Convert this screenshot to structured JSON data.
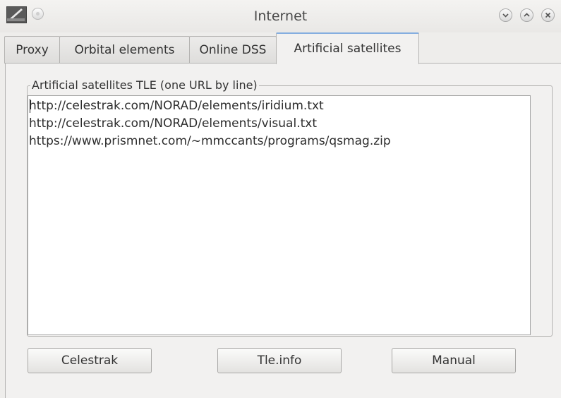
{
  "window": {
    "title": "Internet",
    "controls": [
      "minimize",
      "maximize",
      "close"
    ]
  },
  "tabs": [
    {
      "label": "Proxy",
      "active": false
    },
    {
      "label": "Orbital elements",
      "active": false
    },
    {
      "label": "Online DSS",
      "active": false
    },
    {
      "label": "Artificial satellites",
      "active": true
    }
  ],
  "satellites": {
    "group_label": "Artificial satellites TLE (one URL by line)",
    "urls": [
      "http://celestrak.com/NORAD/elements/iridium.txt",
      "http://celestrak.com/NORAD/elements/visual.txt",
      "https://www.prismnet.com/~mmccants/programs/qsmag.zip"
    ],
    "buttons": {
      "celestrak": "Celestrak",
      "tleinfo": "Tle.info",
      "manual": "Manual"
    }
  },
  "colors": {
    "active_tab_accent": "#85aee0",
    "window_bg": "#eeedeb"
  }
}
